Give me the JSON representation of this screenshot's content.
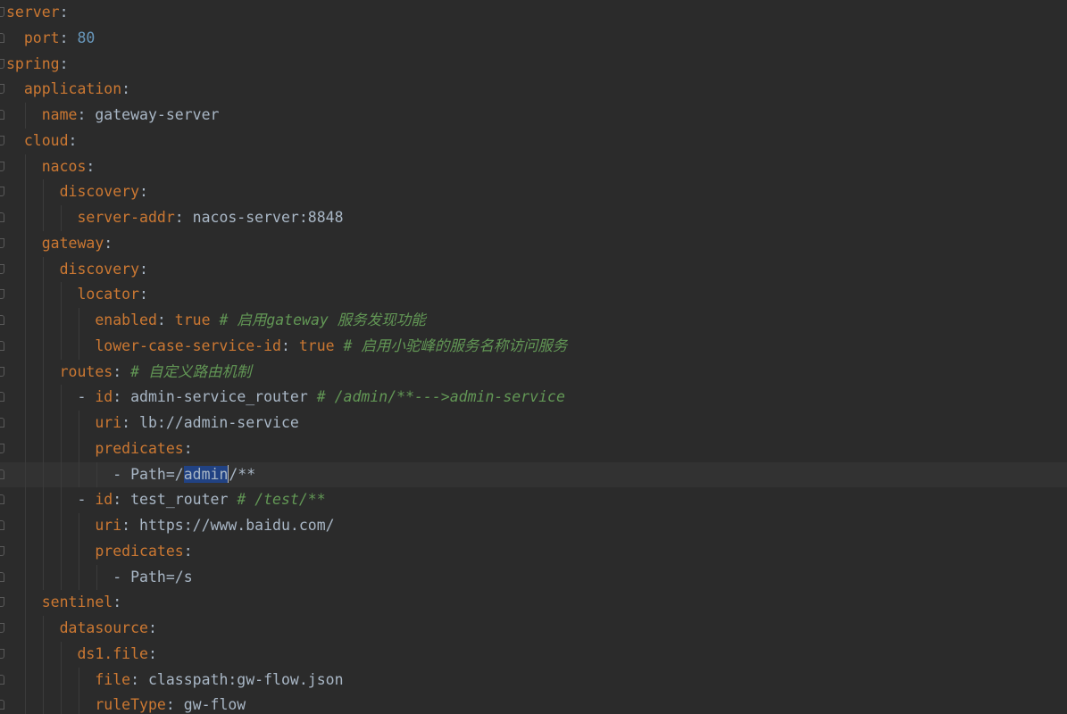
{
  "editor": {
    "language": "yaml",
    "colors": {
      "background": "#2b2b2b",
      "key": "#cc7832",
      "number": "#6897bb",
      "comment": "#629755",
      "text": "#a9b7c6",
      "selection": "#214283",
      "current_line": "#323232"
    },
    "lines": [
      {
        "indent": 0,
        "key": "server",
        "sep": ":"
      },
      {
        "indent": 1,
        "key": "port",
        "sep": ": ",
        "number": "80"
      },
      {
        "indent": 0,
        "key": "spring",
        "sep": ":"
      },
      {
        "indent": 1,
        "key": "application",
        "sep": ":"
      },
      {
        "indent": 2,
        "key": "name",
        "sep": ": ",
        "value": "gateway-server"
      },
      {
        "indent": 1,
        "key": "cloud",
        "sep": ":"
      },
      {
        "indent": 2,
        "key": "nacos",
        "sep": ":"
      },
      {
        "indent": 3,
        "key": "discovery",
        "sep": ":"
      },
      {
        "indent": 4,
        "key": "server-addr",
        "sep": ": ",
        "value": "nacos-server:8848"
      },
      {
        "indent": 2,
        "key": "gateway",
        "sep": ":"
      },
      {
        "indent": 3,
        "key": "discovery",
        "sep": ":"
      },
      {
        "indent": 4,
        "key": "locator",
        "sep": ":"
      },
      {
        "indent": 5,
        "key": "enabled",
        "sep": ": ",
        "keyword": "true",
        "comment": " # 启用gateway 服务发现功能"
      },
      {
        "indent": 5,
        "key": "lower-case-service-id",
        "sep": ": ",
        "keyword": "true",
        "comment": " # 启用小驼峰的服务名称访问服务"
      },
      {
        "indent": 3,
        "key": "routes",
        "sep": ":",
        "comment": " # 自定义路由机制"
      },
      {
        "indent": 4,
        "dash": "- ",
        "key": "id",
        "sep": ": ",
        "value": "admin-service_router",
        "comment": " # /admin/**--->admin-service"
      },
      {
        "indent": 5,
        "key": "uri",
        "sep": ": ",
        "value": "lb://admin-service"
      },
      {
        "indent": 5,
        "key": "predicates",
        "sep": ":"
      },
      {
        "indent": 6,
        "dash": "- ",
        "value": "Path=/",
        "selected": "admin",
        "after": "/**",
        "current": true
      },
      {
        "indent": 4,
        "dash": "- ",
        "key": "id",
        "sep": ": ",
        "value": "test_router",
        "comment": " # /test/**"
      },
      {
        "indent": 5,
        "key": "uri",
        "sep": ": ",
        "value": "https://www.baidu.com/"
      },
      {
        "indent": 5,
        "key": "predicates",
        "sep": ":"
      },
      {
        "indent": 6,
        "dash": "- ",
        "value": "Path=/s"
      },
      {
        "indent": 2,
        "key": "sentinel",
        "sep": ":"
      },
      {
        "indent": 3,
        "key": "datasource",
        "sep": ":"
      },
      {
        "indent": 4,
        "key": "ds1.file",
        "sep": ":"
      },
      {
        "indent": 5,
        "key": "file",
        "sep": ": ",
        "value": "classpath:gw-flow.json"
      },
      {
        "indent": 5,
        "key": "ruleType",
        "sep": ": ",
        "value": "gw-flow"
      }
    ]
  }
}
